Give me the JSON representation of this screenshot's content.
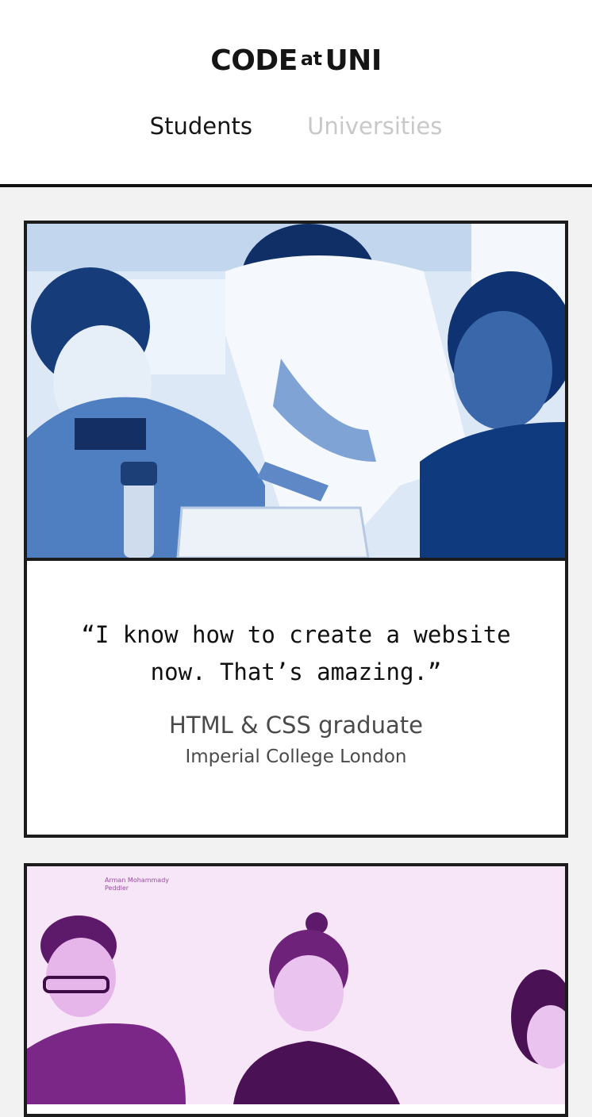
{
  "header": {
    "logo": {
      "main1": "CODE",
      "small": "at",
      "main2": "UNI"
    },
    "tabs": [
      {
        "label": "Students",
        "active": true
      },
      {
        "label": "Universities",
        "active": false
      }
    ]
  },
  "testimonials": [
    {
      "quote_line1": "“I know how to create a website",
      "quote_line2": "now. That’s amazing.”",
      "role": "HTML & CSS graduate",
      "school": "Imperial College London",
      "photo_tint": "#1f5fae"
    },
    {
      "photo_caption_line1": "Arman Mohammady",
      "photo_caption_line2": "Peddler",
      "photo_tint": "#a23fb0"
    }
  ],
  "colors": {
    "header_bg": "#ffffff",
    "page_bg": "#f2f2f2",
    "border": "#1c1c1c",
    "tab_inactive": "#c8c8c8"
  }
}
